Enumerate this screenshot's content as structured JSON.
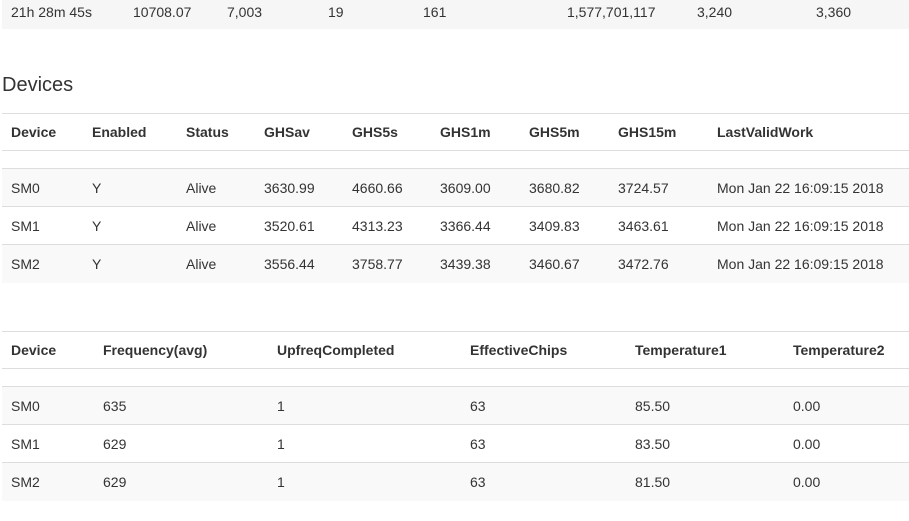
{
  "summary": [
    "21h 28m 45s",
    "10708.07",
    "7,003",
    "19",
    "161",
    "1,577,701,117",
    "3,240",
    "3,360"
  ],
  "devices_title": "Devices",
  "table1": {
    "headers": [
      "Device",
      "Enabled",
      "Status",
      "GHSav",
      "GHS5s",
      "GHS1m",
      "GHS5m",
      "GHS15m",
      "LastValidWork"
    ],
    "rows": [
      [
        "SM0",
        "Y",
        "Alive",
        "3630.99",
        "4660.66",
        "3609.00",
        "3680.82",
        "3724.57",
        "Mon Jan 22 16:09:15 2018"
      ],
      [
        "SM1",
        "Y",
        "Alive",
        "3520.61",
        "4313.23",
        "3366.44",
        "3409.83",
        "3463.61",
        "Mon Jan 22 16:09:15 2018"
      ],
      [
        "SM2",
        "Y",
        "Alive",
        "3556.44",
        "3758.77",
        "3439.38",
        "3460.67",
        "3472.76",
        "Mon Jan 22 16:09:15 2018"
      ]
    ]
  },
  "table2": {
    "headers": [
      "Device",
      "Frequency(avg)",
      "UpfreqCompleted",
      "EffectiveChips",
      "Temperature1",
      "Temperature2"
    ],
    "rows": [
      [
        "SM0",
        "635",
        "1",
        "63",
        "85.50",
        "0.00"
      ],
      [
        "SM1",
        "629",
        "1",
        "63",
        "83.50",
        "0.00"
      ],
      [
        "SM2",
        "629",
        "1",
        "63",
        "81.50",
        "0.00"
      ]
    ]
  }
}
